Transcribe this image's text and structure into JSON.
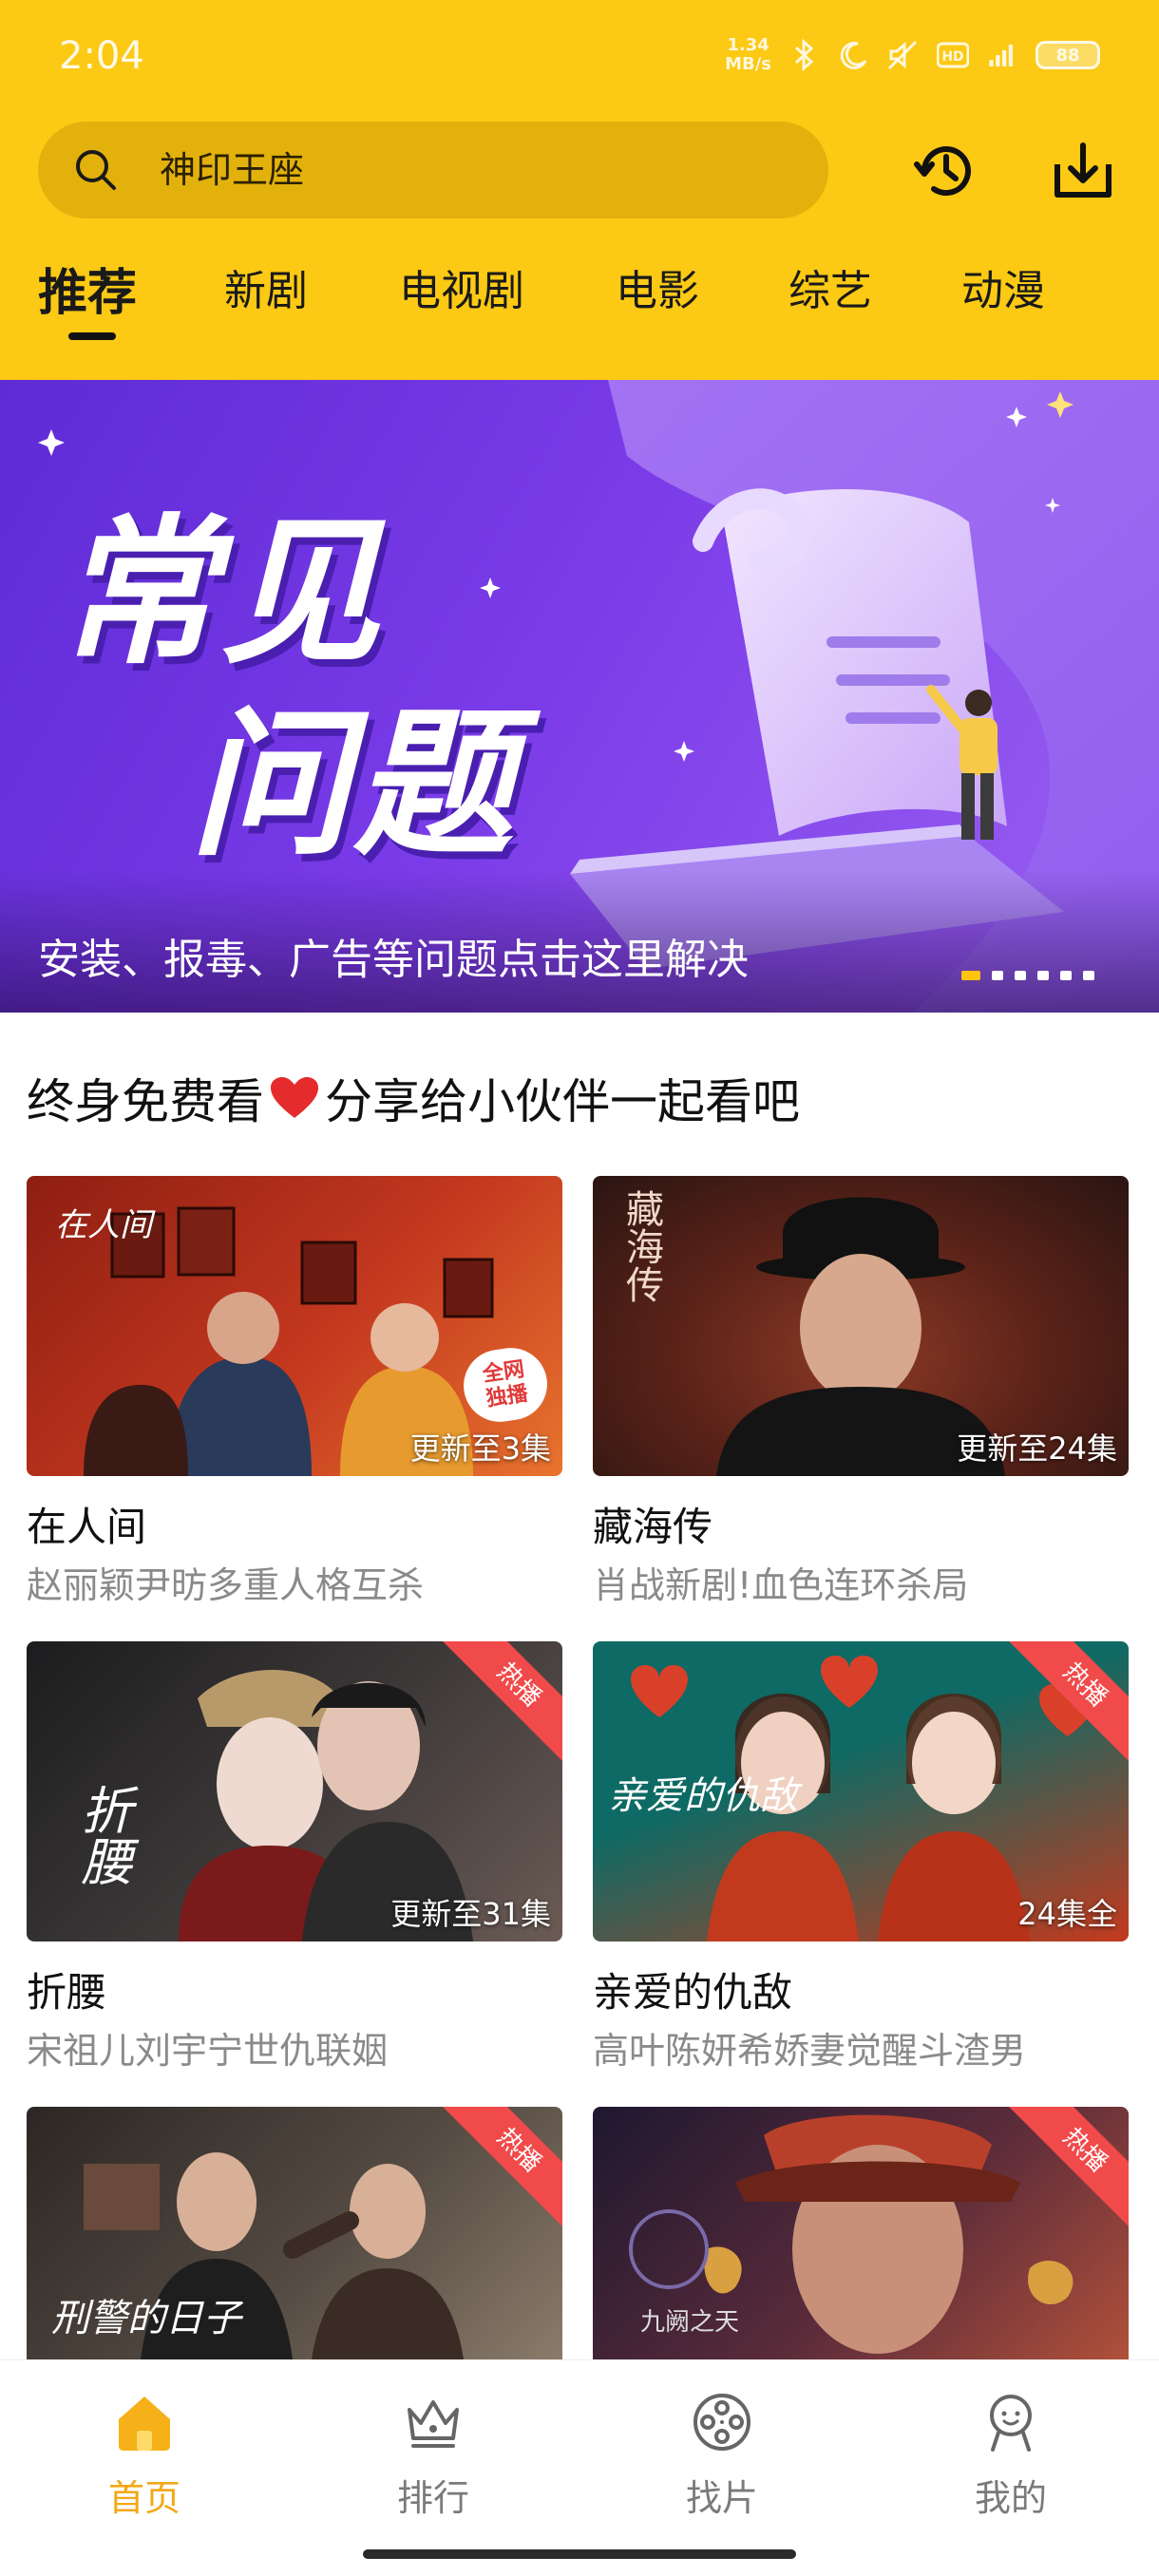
{
  "status_bar": {
    "time": "2:04",
    "net_speed_value": "1.34",
    "net_speed_unit": "MB/s",
    "battery": "88"
  },
  "search": {
    "text": "神印王座"
  },
  "tabs": [
    {
      "label": "推荐",
      "active": true
    },
    {
      "label": "新剧",
      "active": false
    },
    {
      "label": "电视剧",
      "active": false
    },
    {
      "label": "电影",
      "active": false
    },
    {
      "label": "综艺",
      "active": false
    },
    {
      "label": "动漫",
      "active": false
    }
  ],
  "banner": {
    "title_line1": "常见",
    "title_line2": "问题",
    "caption": "安装、报毒、广告等问题点击这里解决",
    "slide_count": 6,
    "active_slide": 1
  },
  "section": {
    "title_part1": "终身免费看",
    "title_part2": "分享给小伙伴一起看吧"
  },
  "shows": [
    {
      "title": "在人间",
      "subtitle": "赵丽颖尹昉多重人格互杀",
      "episode_label": "更新至3集",
      "badge": "全网独播",
      "poster_text": "在人间",
      "poster_colors": [
        "#8E1E12",
        "#C4381F",
        "#E8742E"
      ]
    },
    {
      "title": "藏海传",
      "subtitle": "肖战新剧!血色连环杀局",
      "episode_label": "更新至24集",
      "poster_text": "藏海传",
      "poster_colors": [
        "#2a1512",
        "#5a2218",
        "#8c3a26"
      ]
    },
    {
      "title": "折腰",
      "subtitle": "宋祖儿刘宇宁世仇联姻",
      "episode_label": "更新至31集",
      "corner": "热播",
      "poster_text": "折腰",
      "poster_colors": [
        "#1c1c1e",
        "#3c3838",
        "#6b5b55"
      ]
    },
    {
      "title": "亲爱的仇敌",
      "subtitle": "高叶陈妍希娇妻觉醒斗渣男",
      "episode_label": "24集全",
      "corner": "热播",
      "poster_text": "亲爱的仇敌",
      "poster_colors": [
        "#0E6A64",
        "#C23A1E",
        "#E85A3A"
      ]
    },
    {
      "title": "",
      "subtitle": "",
      "episode_label": "",
      "corner": "热播",
      "poster_text": "刑警的日子",
      "poster_colors": [
        "#2c2724",
        "#544a42",
        "#8a7b6a"
      ]
    },
    {
      "title": "",
      "subtitle": "",
      "episode_label": "",
      "corner": "热播",
      "poster_text": "九阙之天",
      "poster_colors": [
        "#1e1830",
        "#5a2b3a",
        "#b0503a"
      ]
    }
  ],
  "bottom_nav": [
    {
      "label": "首页",
      "icon": "home-icon",
      "active": true
    },
    {
      "label": "排行",
      "icon": "crown-icon",
      "active": false
    },
    {
      "label": "找片",
      "icon": "film-reel-icon",
      "active": false
    },
    {
      "label": "我的",
      "icon": "profile-icon",
      "active": false
    }
  ],
  "colors": {
    "header": "#FCC914",
    "active_nav": "#F2A817",
    "hot_ribbon": "#F04A4A"
  }
}
